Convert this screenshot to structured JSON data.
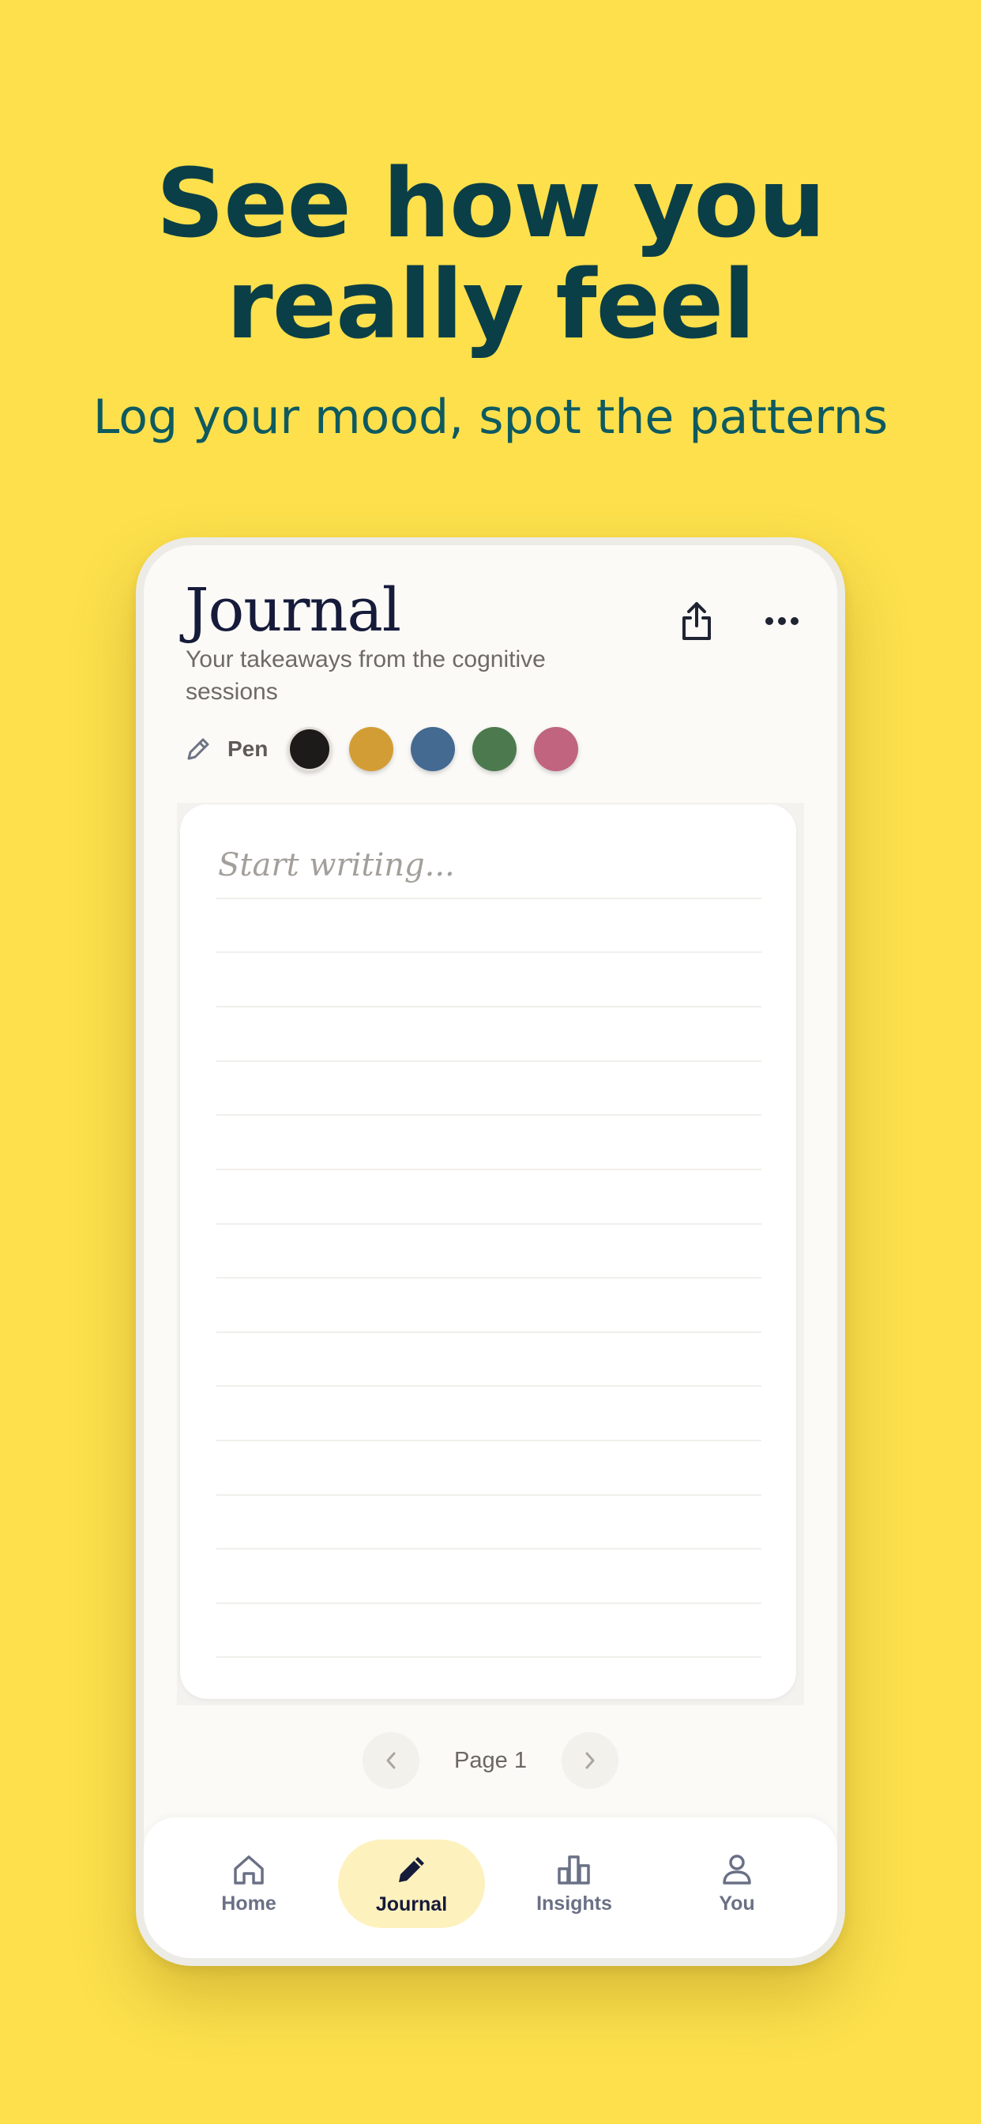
{
  "promo": {
    "headline_line1": "See how you",
    "headline_line2": "really feel",
    "subhead": "Log your mood, spot the patterns"
  },
  "app": {
    "title": "Journal",
    "subtitle": "Your takeaways from the cognitive sessions",
    "actions": [
      {
        "name": "share-icon"
      },
      {
        "name": "more-icon"
      }
    ],
    "pen": {
      "icon": "pencil-icon",
      "label": "Pen",
      "colors": [
        "#1C1B19",
        "#D39D36",
        "#456A92",
        "#4C7A4E",
        "#C0647F"
      ],
      "selected_index": 0
    },
    "editor": {
      "placeholder": "Start writing..."
    },
    "pager": {
      "label": "Page 1",
      "prev_icon": "chevron-left-icon",
      "next_icon": "chevron-right-icon"
    },
    "nav": {
      "items": [
        {
          "label": "Home",
          "icon": "home-icon"
        },
        {
          "label": "Journal",
          "icon": "pencil-icon"
        },
        {
          "label": "Insights",
          "icon": "bar-chart-icon"
        },
        {
          "label": "You",
          "icon": "person-icon"
        }
      ],
      "active_index": 1,
      "active_color": "#FDF1BE"
    }
  }
}
